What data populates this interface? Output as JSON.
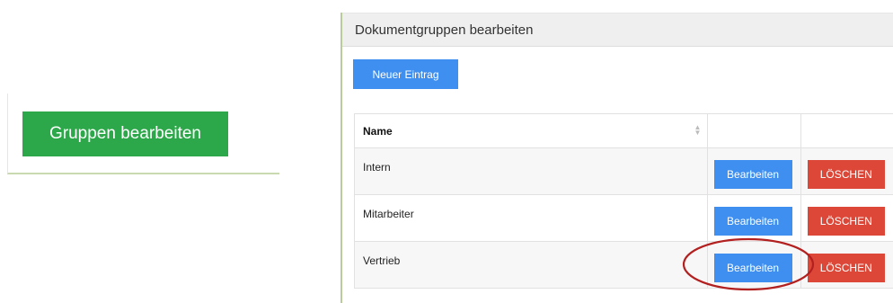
{
  "left_panel": {
    "button_label": "Gruppen bearbeiten"
  },
  "doc_panel": {
    "title": "Dokumentgruppen bearbeiten",
    "new_entry_label": "Neuer Eintrag",
    "table": {
      "columns": [
        "Name",
        "",
        ""
      ],
      "rows": [
        {
          "name": "Intern",
          "edit_label": "Bearbeiten",
          "delete_label": "LÖSCHEN"
        },
        {
          "name": "Mitarbeiter",
          "edit_label": "Bearbeiten",
          "delete_label": "LÖSCHEN"
        },
        {
          "name": "Vertrieb",
          "edit_label": "Bearbeiten",
          "delete_label": "LÖSCHEN"
        }
      ]
    }
  },
  "icons": {
    "sort": "sort-icon",
    "highlight": "highlight-ellipse"
  },
  "colors": {
    "green_button": "#2ca84a",
    "blue_button": "#3e8ff0",
    "red_button": "#dc4738",
    "highlight": "#b32020"
  }
}
